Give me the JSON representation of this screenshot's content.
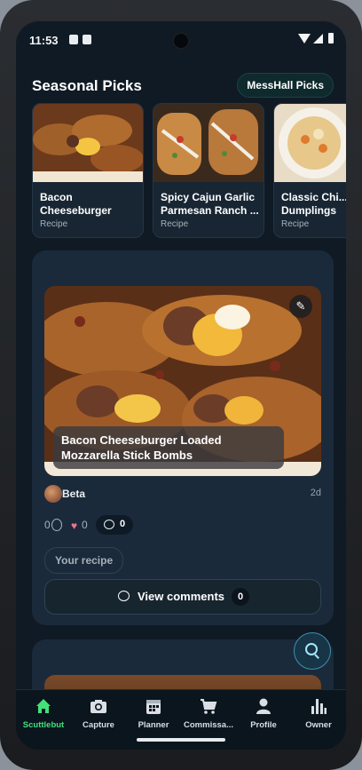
{
  "status_bar": {
    "time": "11:53"
  },
  "seasonal": {
    "title": "Seasonal Picks",
    "pill_label": "MessHall Picks",
    "items": [
      {
        "title": "Bacon Cheeseburger Loa...",
        "subtitle": "Recipe"
      },
      {
        "title": "Spicy Cajun Garlic Parmesan Ranch ...",
        "subtitle": "Recipe"
      },
      {
        "title": "Classic Chi... Dumplings",
        "subtitle": "Recipe"
      }
    ]
  },
  "post": {
    "caption": "Bacon Cheeseburger Loaded Mozzarella Stick Bombs",
    "author": "Beta",
    "age": "2d",
    "medal_count": "0",
    "likes": "0",
    "comments_count": "0",
    "your_recipe_label": "Your recipe",
    "view_comments_label": "View comments",
    "view_comments_count": "0"
  },
  "nav": {
    "items": [
      {
        "label": "Scuttlebut",
        "icon": "home-icon",
        "active": true
      },
      {
        "label": "Capture",
        "icon": "camera-icon",
        "active": false
      },
      {
        "label": "Planner",
        "icon": "calendar-icon",
        "active": false
      },
      {
        "label": "Commissa...",
        "icon": "cart-icon",
        "active": false
      },
      {
        "label": "Profile",
        "icon": "person-icon",
        "active": false
      },
      {
        "label": "Owner",
        "icon": "bar-chart-icon",
        "active": false
      }
    ]
  },
  "colors": {
    "background": "#0f1a24",
    "card": "#1b2a3a",
    "accent_green": "#43e07a",
    "heart": "#f07489"
  }
}
